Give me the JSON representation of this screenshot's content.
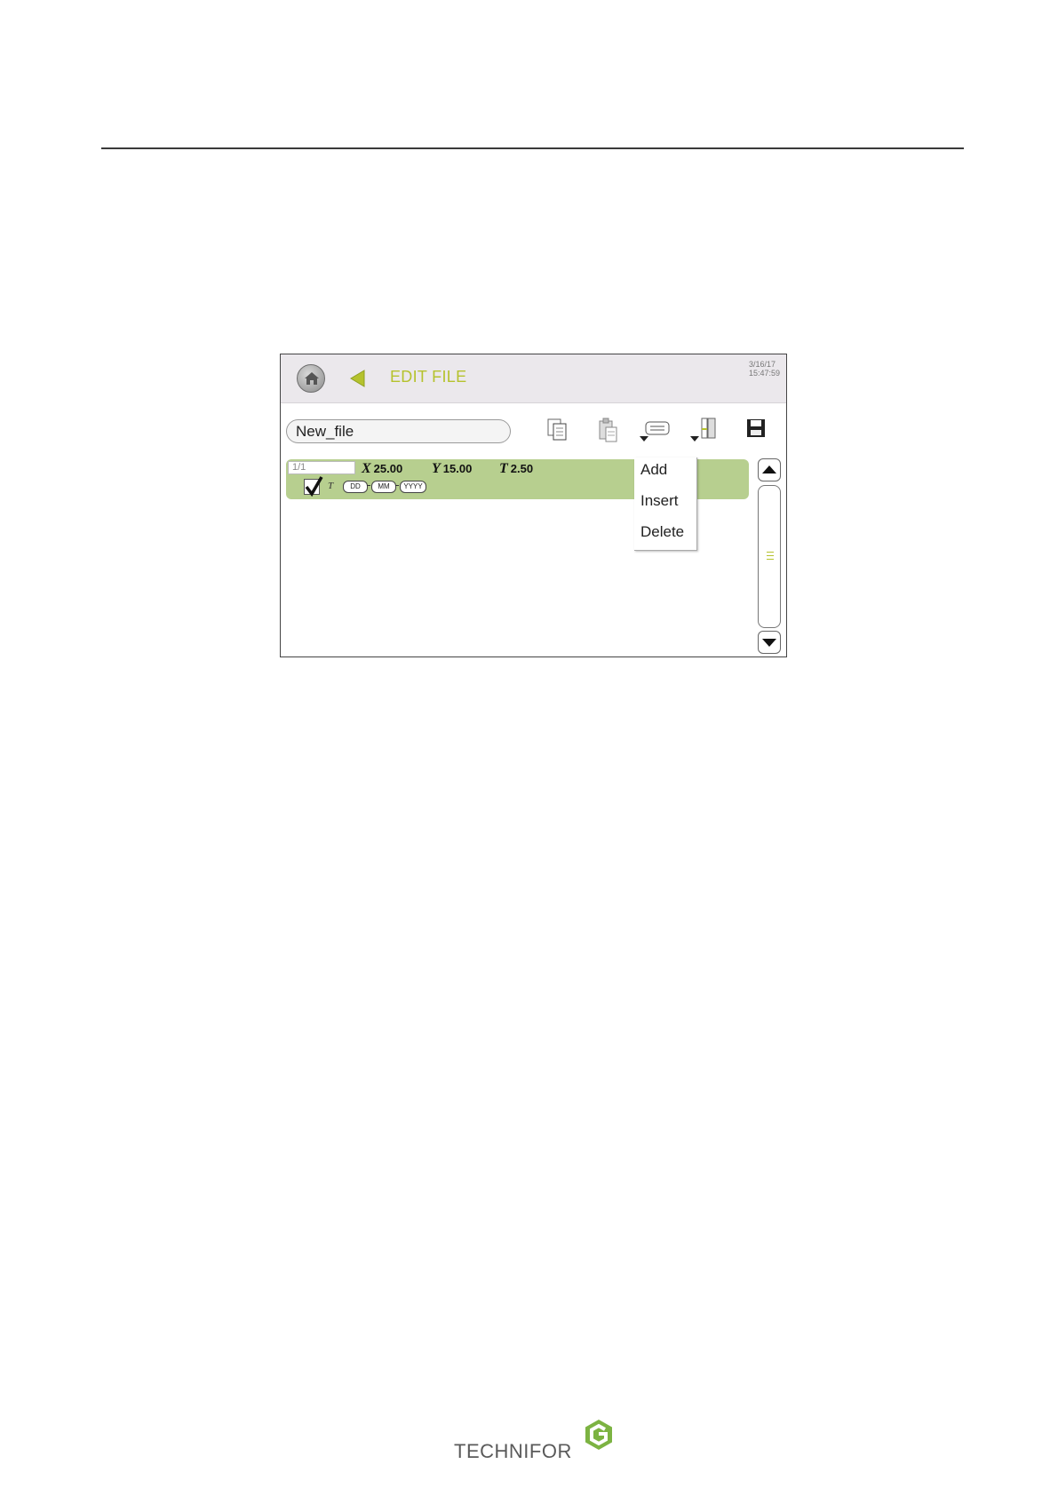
{
  "screen": {
    "title": "EDIT FILE",
    "date": "3/16/17",
    "time": "15:47:59",
    "filename": "New_file",
    "row": {
      "index": "1/1",
      "x_label": "X",
      "x_value": "25.00",
      "y_label": "Y",
      "y_value": "15.00",
      "t_label": "T",
      "t_value": "2.50",
      "text_mark": "T",
      "chips": [
        "DD",
        "MM",
        "YYYY"
      ]
    },
    "menu": {
      "items": [
        "Add",
        "Insert",
        "Delete"
      ]
    }
  },
  "footer": {
    "logo_text": "TECHNIFOR"
  },
  "colors": {
    "accent": "#b5c22d",
    "row_bg": "#b7cf8f",
    "title_bar": "#ebe8ec"
  }
}
